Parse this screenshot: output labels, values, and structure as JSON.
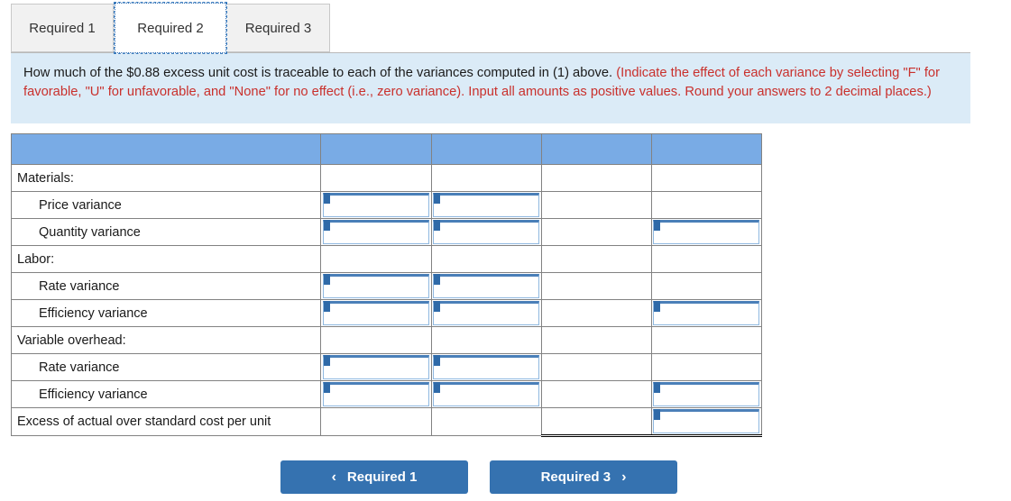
{
  "tabs": [
    {
      "label": "Required 1",
      "active": false
    },
    {
      "label": "Required 2",
      "active": true
    },
    {
      "label": "Required 3",
      "active": false
    }
  ],
  "banner": {
    "question": "How much of the $0.88 excess unit cost is traceable to each of the variances computed in (1) above. ",
    "hint": "(Indicate the effect of each variance by selecting \"F\" for favorable, \"U\" for unfavorable, and \"None\" for no effect (i.e., zero variance). Input all amounts as positive values. Round your answers to 2 decimal places.)"
  },
  "table": {
    "headers": [
      "",
      "",
      "",
      "",
      ""
    ],
    "rows": [
      {
        "label": "Materials:",
        "indent": false,
        "inputs": [
          false,
          false,
          false,
          false
        ],
        "values": [
          "",
          "",
          "",
          ""
        ],
        "ruled": false
      },
      {
        "label": "Price variance",
        "indent": true,
        "inputs": [
          true,
          true,
          false,
          false
        ],
        "values": [
          "",
          "",
          "",
          ""
        ],
        "ruled": false
      },
      {
        "label": "Quantity variance",
        "indent": true,
        "inputs": [
          true,
          true,
          false,
          true
        ],
        "values": [
          "",
          "",
          "",
          ""
        ],
        "ruled": false
      },
      {
        "label": "Labor:",
        "indent": false,
        "inputs": [
          false,
          false,
          false,
          false
        ],
        "values": [
          "",
          "",
          "",
          ""
        ],
        "ruled": false
      },
      {
        "label": "Rate variance",
        "indent": true,
        "inputs": [
          true,
          true,
          false,
          false
        ],
        "values": [
          "",
          "",
          "",
          ""
        ],
        "ruled": false
      },
      {
        "label": "Efficiency variance",
        "indent": true,
        "inputs": [
          true,
          true,
          false,
          true
        ],
        "values": [
          "",
          "",
          "",
          ""
        ],
        "ruled": false
      },
      {
        "label": "Variable overhead:",
        "indent": false,
        "inputs": [
          false,
          false,
          false,
          false
        ],
        "values": [
          "",
          "",
          "",
          ""
        ],
        "ruled": false
      },
      {
        "label": "Rate variance",
        "indent": true,
        "inputs": [
          true,
          true,
          false,
          false
        ],
        "values": [
          "",
          "",
          "",
          ""
        ],
        "ruled": false
      },
      {
        "label": "Efficiency variance",
        "indent": true,
        "inputs": [
          true,
          true,
          false,
          true
        ],
        "values": [
          "",
          "",
          "",
          ""
        ],
        "ruled": false
      },
      {
        "label": "Excess of actual over standard cost per unit",
        "indent": false,
        "inputs": [
          false,
          false,
          false,
          true
        ],
        "values": [
          "",
          "",
          "",
          ""
        ],
        "ruled": true
      }
    ]
  },
  "nav": {
    "prev_label": "Required 1",
    "next_label": "Required 3",
    "prev_icon": "chevron-left-icon",
    "next_icon": "chevron-right-icon",
    "prev_glyph": "‹",
    "next_glyph": "›"
  },
  "colors": {
    "header_blue": "#79abe5",
    "banner_blue": "#dbebf7",
    "hint_red": "#c9302c",
    "button_blue": "#3572b0",
    "input_border": "#8fb8e0",
    "input_top": "#4a7fb8"
  }
}
